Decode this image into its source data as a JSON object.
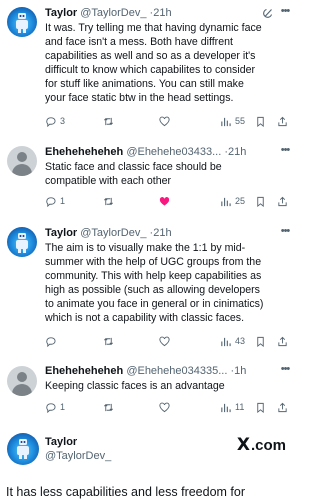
{
  "tweets": [
    {
      "name": "Taylor",
      "handle": "@TaylorDev_",
      "dot": "·",
      "time": "21h",
      "text": "It was. Try telling me that having dynamic face\nand face isn't a mess. Both have diffrent\ncapabilities as well and so as a developer it's\ndifficult to know which capabilites to consider\nfor stuff like animations. You can still make\nyour face static btw in the head settings.",
      "replies": "3",
      "retweets": "",
      "likes": "",
      "views": "55",
      "avatar_icon": "robot-avatar",
      "liked": false
    },
    {
      "name": "Eheheheheheh",
      "handle": "@Ehehehe03433...",
      "dot": "·",
      "time": "21h",
      "text": "Static face and classic face should be\ncompatible with each other",
      "replies": "1",
      "retweets": "",
      "likes": "",
      "views": "25",
      "avatar_icon": "default-user-avatar",
      "liked": true
    },
    {
      "name": "Taylor",
      "handle": "@TaylorDev_",
      "dot": "·",
      "time": "21h",
      "text": "The aim is to visually make the 1:1 by mid-\nsummer with the help of UGC groups from the\ncommunity. This with help keep capabilities as\nhigh as possible (such as allowing developers\nto animate you face in general or in cinimatics)\nwhich is not a capability with classic faces.",
      "replies": "",
      "retweets": "",
      "likes": "",
      "views": "43",
      "avatar_icon": "robot-avatar",
      "liked": false
    },
    {
      "name": "Eheheheheheh",
      "handle": "@Ehehehe034335...",
      "dot": "·",
      "time": "1h",
      "text": "Keeping classic faces is an advantage",
      "replies": "1",
      "retweets": "",
      "likes": "",
      "views": "11",
      "avatar_icon": "default-user-avatar",
      "liked": false
    }
  ],
  "card": {
    "name": "Taylor",
    "handle": "@TaylorDev_",
    "brand": ".com",
    "brand_x": "X"
  },
  "partial_text": "It has less capabilities and less freedom for",
  "colors": {
    "text": "#0f1419",
    "muted": "#536471",
    "like": "#f91880",
    "accent_blue": "#1d9bf0"
  }
}
